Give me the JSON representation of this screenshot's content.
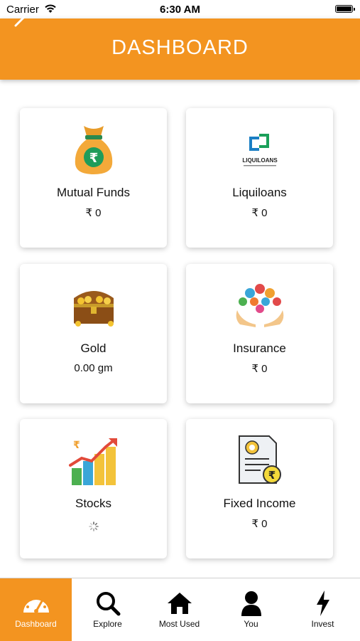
{
  "status_bar": {
    "carrier": "Carrier",
    "time": "6:30 AM"
  },
  "header": {
    "title": "DASHBOARD",
    "accent_color": "#f39420"
  },
  "cards": [
    {
      "name": "Mutual Funds",
      "value": "₹ 0",
      "icon": "money-bag-icon"
    },
    {
      "name": "Liquiloans",
      "value": "₹ 0",
      "icon": "liquiloans-logo",
      "logo_text": "LIQUILOANS"
    },
    {
      "name": "Gold",
      "value": "0.00 gm",
      "icon": "treasure-chest-icon"
    },
    {
      "name": "Insurance",
      "value": "₹ 0",
      "icon": "insurance-hands-icon"
    },
    {
      "name": "Stocks",
      "value": "",
      "icon": "stocks-chart-icon"
    },
    {
      "name": "Fixed Income",
      "value": "₹ 0",
      "icon": "certificate-icon"
    }
  ],
  "bottom_nav": [
    {
      "label": "Dashboard",
      "icon": "speedometer-icon",
      "active": true
    },
    {
      "label": "Explore",
      "icon": "search-icon",
      "active": false
    },
    {
      "label": "Most Used",
      "icon": "home-icon",
      "active": false
    },
    {
      "label": "You",
      "icon": "user-icon",
      "active": false
    },
    {
      "label": "Invest",
      "icon": "lightning-icon",
      "active": false
    }
  ]
}
